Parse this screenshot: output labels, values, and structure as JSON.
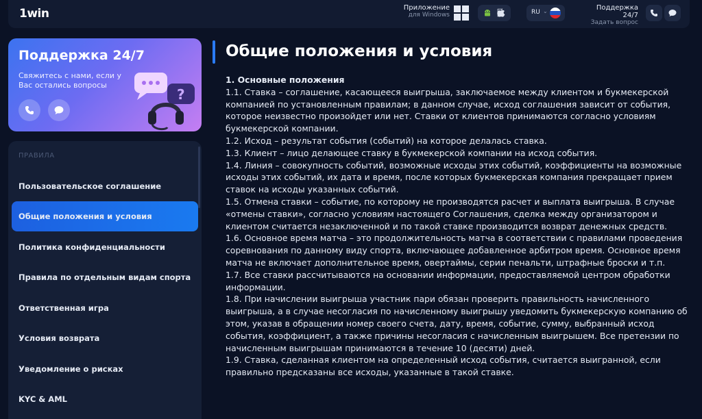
{
  "header": {
    "logo_prefix": "1",
    "logo_name": "win",
    "app_title": "Приложение",
    "app_sub": "для Windows",
    "lang": "RU",
    "support_title": "Поддержка 24/7",
    "support_sub": "Задать вопрос"
  },
  "support_card": {
    "title": "Поддержка 24/7",
    "description": "Свяжитесь с нами, если у Вас остались вопросы",
    "icons": [
      "phone-icon",
      "chat-icon"
    ]
  },
  "sidebar": {
    "heading": "ПРАВИЛА",
    "items": [
      {
        "label": "Пользовательское соглашение",
        "active": false
      },
      {
        "label": "Общие положения и условия",
        "active": true
      },
      {
        "label": "Политика конфиденциальности",
        "active": false
      },
      {
        "label": "Правила по отдельным видам спорта",
        "active": false
      },
      {
        "label": "Ответственная игра",
        "active": false
      },
      {
        "label": "Условия возврата",
        "active": false
      },
      {
        "label": "Уведомление о рисках",
        "active": false
      },
      {
        "label": "KYC & AML",
        "active": false
      }
    ]
  },
  "content": {
    "title": "Общие положения и условия",
    "section": "1. Основные положения",
    "paragraphs": [
      "1.1. Ставка – соглашение, касающееся выигрыша, заключаемое между клиентом и букмекерской компанией по установленным правилам; в данном случае, исход соглашения зависит от события, которое неизвестно произойдет или нет. Ставки от клиентов принимаются согласно условиям букмекерской компании.",
      "1.2. Исход – результат события (событий) на которое делалась ставка.",
      "1.3. Клиент – лицо делающее ставку в букмекерской компании на исход события.",
      "1.4. Линия – совокупность событий, возможные исходы этих событий, коэффициенты на возможные исходы этих событий, их дата и время, после которых букмекерская компания прекращает прием ставок на исходы указанных событий.",
      "1.5. Отмена ставки – событие, по которому не производятся расчет и выплата выигрыша. В случае «отмены ставки», согласно условиям настоящего Соглашения, сделка между организатором и клиентом считается незаключенной и по такой ставке производится возврат денежных средств.",
      "1.6. Основное время матча – это продолжительность матча в соответствии с правилами проведения соревнования по данному виду спорта, включающее добавленное арбитром время. Основное время матча не включает дополнительное время, овертаймы, серии пенальти, штрафные броски и т.п.",
      "1.7. Все ставки рассчитываются на основании информации, предоставляемой центром обработки информации.",
      "1.8. При начислении выигрыша участник пари обязан проверить правильность начисленного выигрыша, а в случае несогласия по начисленному выигрышу уведомить букмекерскую компанию об этом, указав в обращении номер своего счета, дату, время, событие, сумму, выбранный исход события, коэффициент, а также причины несогласия с начисленным выигрышем. Все претензии по начисленным выигрышам принимаются в течение 10 (десяти) дней.",
      "1.9. Ставка, сделанная клиентом на определенный исход события, считается выигранной, если правильно предсказаны все исходы, указанные в такой ставке."
    ]
  },
  "colors": {
    "background": "#0b1225",
    "accent": "#1a7af0",
    "card_gradient_start": "#3c73f0",
    "card_gradient_end": "#c57ef2"
  }
}
